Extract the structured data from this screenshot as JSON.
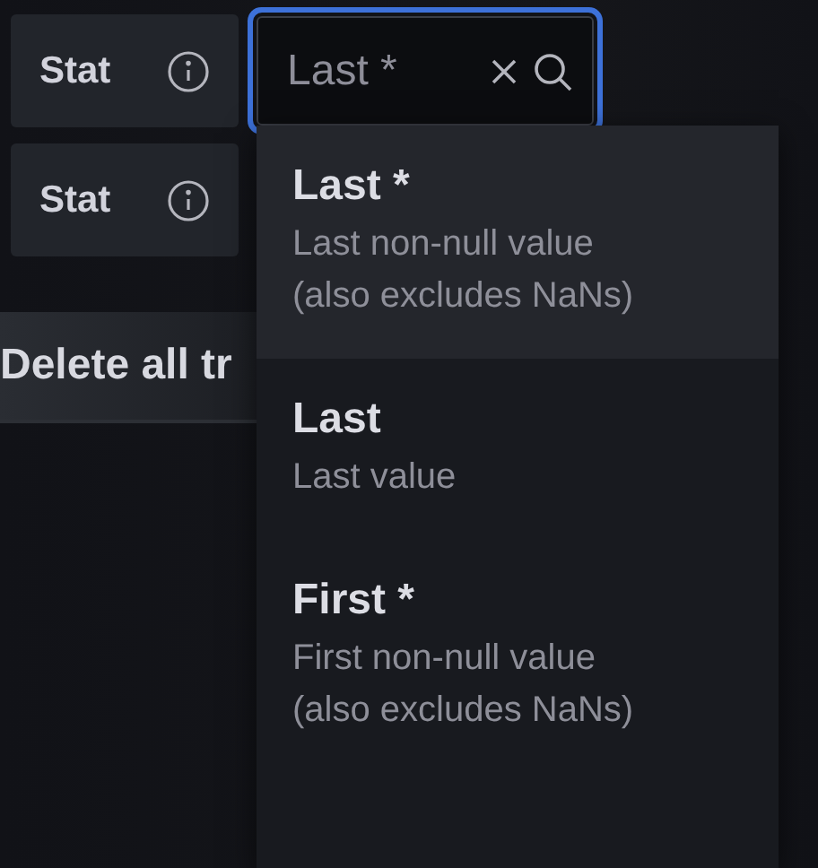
{
  "rows": [
    {
      "label": "Stat",
      "field": {
        "placeholder": "Last *",
        "focused": true
      }
    },
    {
      "label": "Stat"
    }
  ],
  "delete_button": {
    "label": "Delete all tr"
  },
  "dropdown": {
    "options": [
      {
        "title": "Last *",
        "description": "Last non-null value (also excludes NaNs)",
        "selected": true
      },
      {
        "title": "Last",
        "description": "Last value",
        "selected": false
      },
      {
        "title": "First *",
        "description": "First non-null value (also excludes NaNs)",
        "selected": false
      }
    ]
  }
}
